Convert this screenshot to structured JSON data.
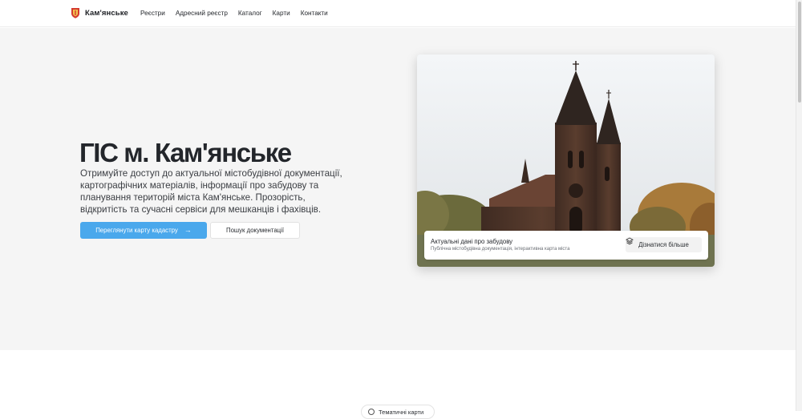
{
  "brand": {
    "name": "Кам'янське",
    "logo_icon": "city-coat-of-arms-icon"
  },
  "nav": {
    "items": [
      "Реєстри",
      "Адресний реєстр",
      "Каталог",
      "Карти",
      "Контакти"
    ]
  },
  "hero": {
    "title": "ГІС м. Кам'янське",
    "description": "Отримуйте доступ до актуальної містобудівної документації, картографічних матеріалів, інформації про забудову та планування територій міста Кам'янське. Прозорість, відкритість та сучасні сервіси для мешканців і фахівців.",
    "primary_button": "Переглянути карту кадастру",
    "secondary_button": "Пошук документації"
  },
  "photo_card": {
    "caption_title": "Актуальні дані про забудову",
    "caption_subtitle": "Публічна містобудівна документація, інтерактивна карта міста",
    "caption_button": "Дізнатися більше"
  },
  "section_chip": {
    "label": "Тематичні карти"
  },
  "colors": {
    "accent": "#4aa8ec",
    "hero_bg": "#f5f5f5",
    "text": "#23262b"
  }
}
